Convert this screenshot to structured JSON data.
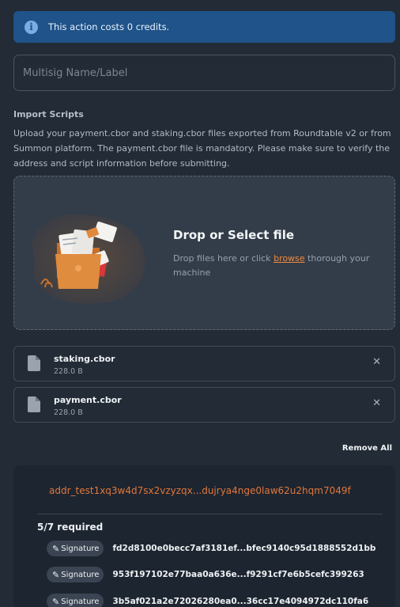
{
  "alert": {
    "icon": "info-icon",
    "icon_glyph": "i",
    "text": "This action costs 0 credits.",
    "color": "#1f5389"
  },
  "name_field": {
    "placeholder": "Multisig Name/Label",
    "value": ""
  },
  "import": {
    "title": "Import Scripts",
    "description": "Upload your payment.cbor and staking.cbor files exported from Roundtable v2 or from Summon platform. The payment.cbor file is mandatory. Please make sure to verify the address and script information before submitting."
  },
  "dropzone": {
    "title": "Drop or Select file",
    "text_before": "Drop files here or click ",
    "link": "browse",
    "text_after": " thorough your machine",
    "illustration": "folder-illustration"
  },
  "files": [
    {
      "name": "staking.cbor",
      "size": "228.0 B",
      "icon": "file-icon",
      "remove_glyph": "✕"
    },
    {
      "name": "payment.cbor",
      "size": "228.0 B",
      "icon": "file-icon",
      "remove_glyph": "✕"
    }
  ],
  "remove_all_label": "Remove All",
  "script": {
    "address": "addr_test1xq3w4d7sx2vzyzqx...dujrya4nge0law62u2hqm7049f",
    "required": "5/7 required",
    "signatures": [
      {
        "label": "Signature",
        "hash": "fd2d8100e0becc7af3181ef...bfec9140c95d1888552d1bb"
      },
      {
        "label": "Signature",
        "hash": "953f197102e77baa0a636e...f9291cf7e6b5cefc399263"
      },
      {
        "label": "Signature",
        "hash": "3b5af021a2e72026280ea0...36cc17e4094972dc110fa6"
      }
    ]
  },
  "colors": {
    "background": "#222b36",
    "accent": "#f08a3c",
    "address": "#e0773c"
  }
}
